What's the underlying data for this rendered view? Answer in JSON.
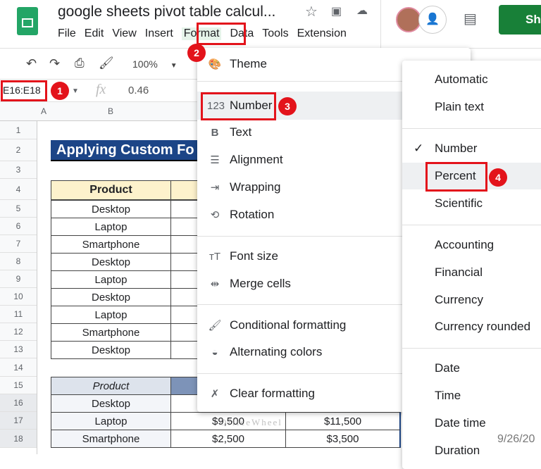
{
  "doc_title": "google sheets pivot table calcul...",
  "menu": [
    "File",
    "Edit",
    "View",
    "Insert",
    "Format",
    "Data",
    "Tools",
    "Extensions"
  ],
  "share_label": "Sh",
  "zoom": "100%",
  "name_box": "E16:E18",
  "formula": "0.46",
  "columns": [
    "A",
    "B"
  ],
  "rows": [
    "1",
    "2",
    "3",
    "4",
    "5",
    "6",
    "7",
    "8",
    "9",
    "10",
    "11",
    "12",
    "13",
    "14",
    "15",
    "16",
    "17",
    "18"
  ],
  "sheet_title": "Applying Custom Fo",
  "table1": {
    "header": "Product",
    "items": [
      "Desktop",
      "Laptop",
      "Smartphone",
      "Desktop",
      "Laptop",
      "Desktop",
      "Laptop",
      "Smartphone",
      "Desktop"
    ]
  },
  "table2": {
    "header": "Product",
    "items": [
      "Desktop",
      "Laptop",
      "Smartphone"
    ],
    "c": [
      "$9,500",
      "$2,500"
    ],
    "d": [
      "$11,500",
      "$3,500"
    ]
  },
  "format_menu": [
    {
      "label": "Theme",
      "icon": "palette-icon"
    },
    {
      "label": "Number",
      "icon": "123-icon"
    },
    {
      "label": "Text",
      "icon": "bold-icon"
    },
    {
      "label": "Alignment",
      "icon": "align-icon"
    },
    {
      "label": "Wrapping",
      "icon": "wrap-icon"
    },
    {
      "label": "Rotation",
      "icon": "rotation-icon"
    },
    {
      "label": "Font size",
      "icon": "font-size-icon"
    },
    {
      "label": "Merge cells",
      "icon": "merge-icon"
    },
    {
      "label": "Conditional formatting",
      "icon": "paint-roller-icon"
    },
    {
      "label": "Alternating colors",
      "icon": "half-circle-icon"
    },
    {
      "label": "Clear formatting",
      "icon": "clear-format-icon"
    }
  ],
  "number_menu": [
    "Automatic",
    "Plain text",
    "Number",
    "Percent",
    "Scientific",
    "Accounting",
    "Financial",
    "Currency",
    "Currency rounded",
    "Date",
    "Time",
    "Date time",
    "Duration"
  ],
  "date_preview": "9/26/20",
  "watermark": "OfficeWheel",
  "badges": [
    "1",
    "2",
    "3",
    "4"
  ],
  "colors": {
    "red": "#e3131b",
    "green": "#188038",
    "title_bg": "#1c4587"
  }
}
